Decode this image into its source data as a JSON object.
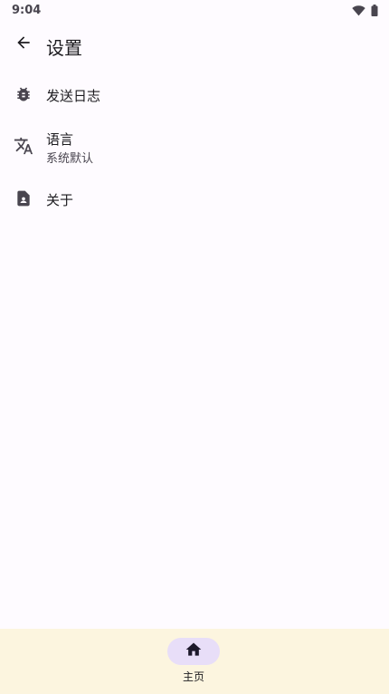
{
  "status_bar": {
    "time": "9:04",
    "icons": [
      "wifi-icon",
      "battery-icon"
    ]
  },
  "app_bar": {
    "back_icon": "arrow-left-icon",
    "title": "设置"
  },
  "settings": {
    "items": [
      {
        "icon": "bug-icon",
        "label": "发送日志"
      },
      {
        "icon": "translate-icon",
        "label": "语言",
        "sublabel": "系统默认"
      },
      {
        "icon": "contact-file-icon",
        "label": "关于"
      }
    ]
  },
  "bottom_nav": {
    "items": [
      {
        "icon": "home-icon",
        "label": "主页",
        "selected": true
      }
    ]
  },
  "colors": {
    "background": "#fefbff",
    "nav_background": "#fcf5df",
    "nav_indicator": "#e8def8",
    "text_primary": "#1c1b1f",
    "text_secondary": "#49454f"
  }
}
